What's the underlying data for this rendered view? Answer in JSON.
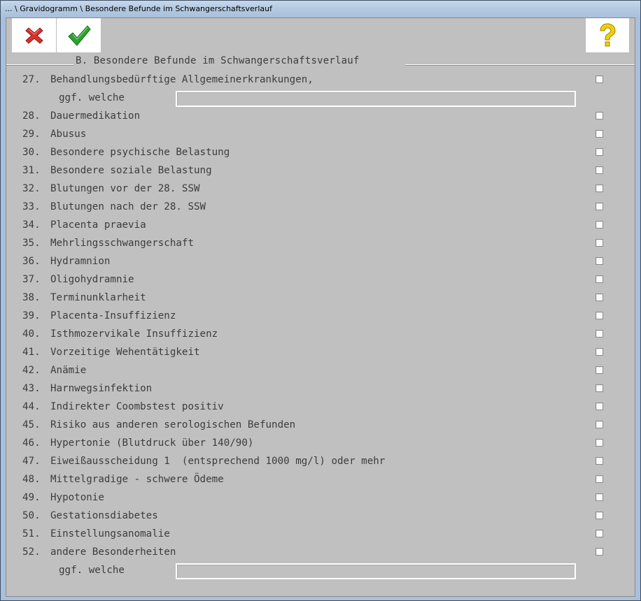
{
  "window": {
    "title": "... \\ Gravidogramm \\ Besondere Befunde im Schwangerschaftsverlauf"
  },
  "toolbar": {
    "cancel_icon": "red-x-icon",
    "confirm_icon": "green-check-icon",
    "help_icon": "yellow-question-icon"
  },
  "colors": {
    "client_bg": "#c0c0c0",
    "text": "#3c3c3c",
    "cancel": "#d9302c",
    "confirm": "#2fa12f",
    "help": "#f2d000"
  },
  "section": {
    "title": "B. Besondere Befunde im Schwangerschaftsverlauf"
  },
  "items": [
    {
      "num": "27.",
      "label": "Behandlungsbedürftige Allgemeinerkrankungen,",
      "checked": false
    },
    {
      "num": "28.",
      "label": "Dauermedikation",
      "checked": false
    },
    {
      "num": "29.",
      "label": "Abusus",
      "checked": false
    },
    {
      "num": "30.",
      "label": "Besondere psychische Belastung",
      "checked": false
    },
    {
      "num": "31.",
      "label": "Besondere soziale Belastung",
      "checked": false
    },
    {
      "num": "32.",
      "label": "Blutungen vor der 28. SSW",
      "checked": false
    },
    {
      "num": "33.",
      "label": "Blutungen nach der 28. SSW",
      "checked": false
    },
    {
      "num": "34.",
      "label": "Placenta praevia",
      "checked": false
    },
    {
      "num": "35.",
      "label": "Mehrlingsschwangerschaft",
      "checked": false
    },
    {
      "num": "36.",
      "label": "Hydramnion",
      "checked": false
    },
    {
      "num": "37.",
      "label": "Oligohydramnie",
      "checked": false
    },
    {
      "num": "38.",
      "label": "Terminunklarheit",
      "checked": false
    },
    {
      "num": "39.",
      "label": "Placenta-Insuffizienz",
      "checked": false
    },
    {
      "num": "40.",
      "label": "Isthmozervikale Insuffizienz",
      "checked": false
    },
    {
      "num": "41.",
      "label": "Vorzeitige Wehentätigkeit",
      "checked": false
    },
    {
      "num": "42.",
      "label": "Anämie",
      "checked": false
    },
    {
      "num": "43.",
      "label": "Harnwegsinfektion",
      "checked": false
    },
    {
      "num": "44.",
      "label": "Indirekter Coombstest positiv",
      "checked": false
    },
    {
      "num": "45.",
      "label": "Risiko aus anderen serologischen Befunden",
      "checked": false
    },
    {
      "num": "46.",
      "label": "Hypertonie (Blutdruck über 140/90)",
      "checked": false
    },
    {
      "num": "47.",
      "label": "Eiweißausscheidung 1  (entsprechend 1000 mg/l) oder mehr",
      "checked": false
    },
    {
      "num": "48.",
      "label": "Mittelgradige - schwere Ödeme",
      "checked": false
    },
    {
      "num": "49.",
      "label": "Hypotonie",
      "checked": false
    },
    {
      "num": "50.",
      "label": "Gestationsdiabetes",
      "checked": false
    },
    {
      "num": "51.",
      "label": "Einstellungsanomalie",
      "checked": false
    },
    {
      "num": "52.",
      "label": "andere Besonderheiten",
      "checked": false
    }
  ],
  "welche_fields": [
    {
      "label": "ggf. welche",
      "value": ""
    },
    {
      "label": "ggf. welche",
      "value": ""
    }
  ]
}
